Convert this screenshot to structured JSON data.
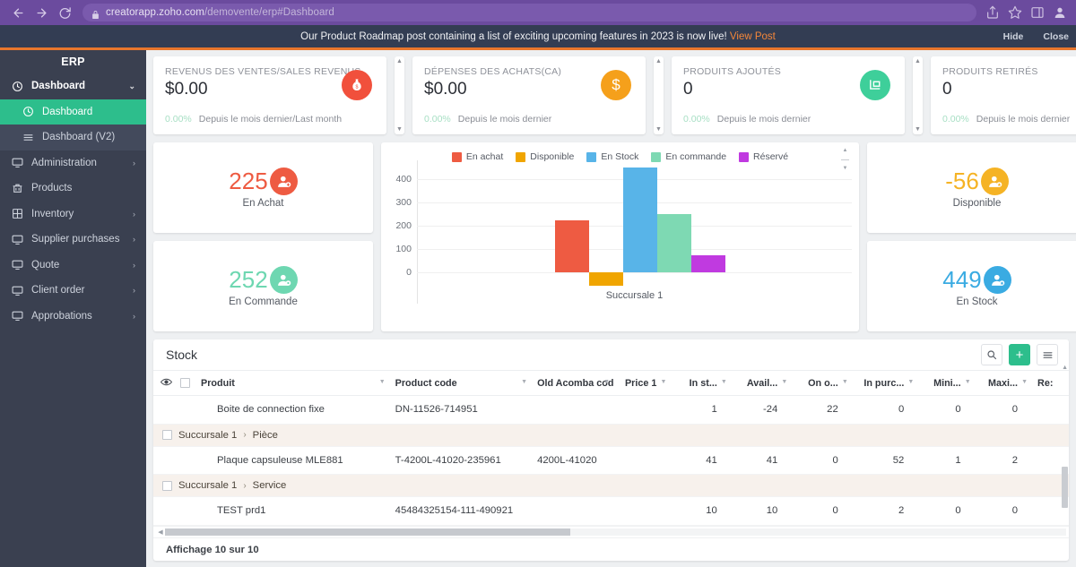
{
  "browser": {
    "back_icon": "back-arrow-icon",
    "forward_icon": "forward-arrow-icon",
    "reload_icon": "reload-icon",
    "lock_icon": "lock-icon",
    "url_prefix": "creatorapp.zoho.com",
    "url_path": "/demovente/erp#Dashboard",
    "share_icon": "share-icon",
    "bookmark_icon": "star-icon",
    "sidepanel_icon": "side-panel-icon",
    "profile_icon": "profile-avatar-icon"
  },
  "banner": {
    "message": "Our Product Roadmap post containing a list of exciting upcoming features in 2023 is now live!",
    "link_label": "View Post",
    "hide_label": "Hide",
    "close_label": "Close",
    "background": "#333d53",
    "link_color": "#f5873a"
  },
  "sidebar": {
    "title": "ERP",
    "accent_color": "#e8762c",
    "active_color": "#2dbe8c",
    "items": [
      {
        "label": "Dashboard",
        "icon": "dashboard-icon",
        "caret": "⌄",
        "state": "group"
      },
      {
        "label": "Dashboard",
        "icon": "dashboard-icon",
        "caret": "",
        "state": "active"
      },
      {
        "label": "Dashboard (V2)",
        "icon": "layers-icon",
        "caret": "",
        "state": "subdark"
      },
      {
        "label": "Administration",
        "icon": "monitor-icon",
        "caret": "›",
        "state": "normal"
      },
      {
        "label": "Products",
        "icon": "bank-icon",
        "caret": "",
        "state": "normal"
      },
      {
        "label": "Inventory",
        "icon": "grid-icon",
        "caret": "›",
        "state": "normal"
      },
      {
        "label": "Supplier purchases",
        "icon": "monitor-icon",
        "caret": "›",
        "state": "normal"
      },
      {
        "label": "Quote",
        "icon": "monitor-icon",
        "caret": "›",
        "state": "normal"
      },
      {
        "label": "Client order",
        "icon": "monitor-icon",
        "caret": "›",
        "state": "normal"
      },
      {
        "label": "Approbations",
        "icon": "monitor-icon",
        "caret": "›",
        "state": "normal"
      }
    ]
  },
  "kpis": [
    {
      "title": "REVENUS DES VENTES/SALES REVENUS",
      "value": "$0.00",
      "pct": "0.00%",
      "sub": "Depuis le mois dernier/Last month",
      "icon": "money-bag-icon",
      "color": "#f1503c",
      "glyph": "💰"
    },
    {
      "title": "DÉPENSES DES ACHATS(CA)",
      "value": "$0.00",
      "pct": "0.00%",
      "sub": "Depuis le mois dernier",
      "icon": "dollar-icon",
      "color": "#f5a01b",
      "glyph": "$"
    },
    {
      "title": "PRODUITS AJOUTÉS",
      "value": "0",
      "pct": "0.00%",
      "sub": "Depuis le mois dernier",
      "icon": "cart-icon",
      "color": "#3ecf9a",
      "glyph": "◳"
    },
    {
      "title": "PRODUITS RETIRÉS",
      "value": "0",
      "pct": "0.00%",
      "sub": "Depuis le mois dernier",
      "icon": "bag-icon",
      "color": "#23a3e8",
      "glyph": "📦"
    }
  ],
  "stats_left": [
    {
      "value": "225",
      "label": "En Achat",
      "color": "#ee5b42",
      "icon": "user-plus-icon"
    },
    {
      "value": "252",
      "label": "En Commande",
      "color": "#6ed7b1",
      "icon": "user-gear-icon"
    }
  ],
  "stats_right": [
    {
      "value": "-56",
      "label": "Disponible",
      "color": "#f5b325",
      "icon": "user-star-icon"
    },
    {
      "value": "449",
      "label": "En Stock",
      "color": "#3aabe2",
      "icon": "user-star-icon"
    }
  ],
  "chart_data": {
    "type": "bar",
    "title": "",
    "categories": [
      "Succursale 1"
    ],
    "xlabel": "Succursale 1",
    "ylabel": "",
    "ylim": [
      -100,
      470
    ],
    "grid": true,
    "legend_position": "top",
    "yticks": [
      0,
      100,
      200,
      300,
      400
    ],
    "ytick_labels": [
      "0",
      "100",
      "200",
      "300",
      "400"
    ],
    "series": [
      {
        "name": "En achat",
        "color": "#ee5b42",
        "values": [
          225
        ]
      },
      {
        "name": "Disponible",
        "color": "#f0a500",
        "values": [
          -56
        ]
      },
      {
        "name": "En Stock",
        "color": "#58b4e8",
        "values": [
          449
        ]
      },
      {
        "name": "En commande",
        "color": "#7ed9b3",
        "values": [
          252
        ]
      },
      {
        "name": "Réservé",
        "color": "#c03ae0",
        "values": [
          72
        ]
      }
    ]
  },
  "table": {
    "title": "Stock",
    "search_icon": "search-icon",
    "add_icon": "plus-icon",
    "menu_icon": "hamburger-menu-icon",
    "eye_icon": "eye-icon",
    "headers": [
      "Produit",
      "Product code",
      "Old Acomba code",
      "Price 1",
      "In st...",
      "Avail...",
      "On o...",
      "In purc...",
      "Mini...",
      "Maxi...",
      "Re:"
    ],
    "rows": [
      {
        "type": "data",
        "produit": "Boite de connection fixe",
        "product_code": "DN-11526-714951",
        "old_acomba": "",
        "price1": "",
        "in_stock": "1",
        "available": "-24",
        "on_order": "22",
        "in_purchase": "0",
        "mini": "0",
        "maxi": "0"
      },
      {
        "type": "group",
        "label_a": "Succursale 1",
        "label_b": "Pièce"
      },
      {
        "type": "data",
        "produit": "Plaque capsuleuse MLE881",
        "product_code": "T-4200L-41020-235961",
        "old_acomba": "4200L-41020",
        "price1": "",
        "in_stock": "41",
        "available": "41",
        "on_order": "0",
        "in_purchase": "52",
        "mini": "1",
        "maxi": "2"
      },
      {
        "type": "group",
        "label_a": "Succursale 1",
        "label_b": "Service"
      },
      {
        "type": "data",
        "produit": "TEST prd1",
        "product_code": "45484325154-111-490921",
        "old_acomba": "",
        "price1": "",
        "in_stock": "10",
        "available": "10",
        "on_order": "0",
        "in_purchase": "2",
        "mini": "0",
        "maxi": "0"
      }
    ],
    "footer": "Affichage 10 sur 10"
  }
}
